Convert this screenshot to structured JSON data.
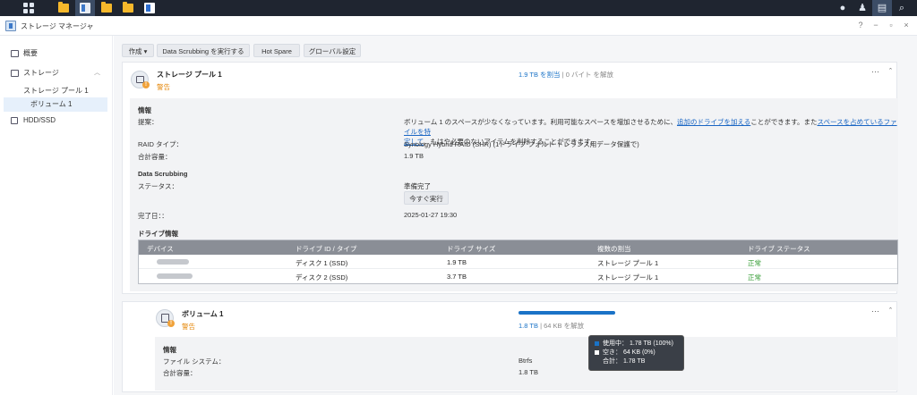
{
  "window": {
    "title": "ストレージ マネージャ"
  },
  "window_controls": [
    "?",
    "−",
    "▫",
    "×"
  ],
  "sidebar": {
    "items": [
      {
        "label": "概要",
        "icon": "overview-icon"
      },
      {
        "label": "ストレージ",
        "icon": "storage-icon"
      },
      {
        "label": "ストレージ プール 1"
      },
      {
        "label": "ボリューム 1"
      },
      {
        "label": "HDD/SSD",
        "icon": "hdd-icon"
      }
    ]
  },
  "toolbar": {
    "create": "作成",
    "scrubbing": "Data Scrubbing を実行する",
    "hot_spare": "Hot Spare",
    "global_settings": "グローバル設定"
  },
  "pool": {
    "title": "ストレージ プール 1",
    "status": "警告",
    "allocated": "1.9 TB を割当",
    "separator": "|",
    "released": "0 バイト を解放",
    "more": "···",
    "collapse": "ˆ",
    "info_header": "情報",
    "suggestion_label": "提案：",
    "suggestion_text_1": "ボリューム 1 のスペースが少なくなっています。利用可能なスペースを増加させるために、",
    "suggestion_link_1": "追加のドライブを加える",
    "suggestion_text_2": "ことができます。また",
    "suggestion_link_2a": "スペースを占めているファイルを特",
    "suggestion_link_2b": "定して",
    "suggestion_text_3": "、もはや必要のないアイテムを削除することができます。",
    "raid_label": "RAID タイプ：",
    "raid_value": "Synology Hybrid RAID (SHR) (1ドライブ フォルト トレランス用データ保護で)",
    "capacity_label": "合計容量：",
    "capacity_value": "1.9 TB",
    "scrubbing_header": "Data Scrubbing",
    "scrub_status_label": "ステータス：",
    "scrub_status_value": "準備完了",
    "run_now": "今すぐ実行",
    "completed_label": "完了日：：",
    "completed_value": "2025-01-27 19:30",
    "drive_header": "ドライブ情報"
  },
  "drive_table": {
    "columns": [
      "デバイス",
      "ドライブ ID / タイプ",
      "ドライブ サイズ",
      "複数の割当",
      "ドライブ ステータス"
    ],
    "rows": [
      {
        "id": "ディスク 1 (SSD)",
        "size": "1.9 TB",
        "alloc": "ストレージ プール 1",
        "status": "正常"
      },
      {
        "id": "ディスク 2 (SSD)",
        "size": "3.7 TB",
        "alloc": "ストレージ プール 1",
        "status": "正常"
      }
    ]
  },
  "volume": {
    "title": "ボリューム 1",
    "status": "警告",
    "used": "1.8 TB",
    "separator": "|",
    "free": "64 KB を解放",
    "usage_fraction": 1.0,
    "more": "···",
    "collapse": "ˆ",
    "info_header": "情報",
    "fs_label": "ファイル システム：",
    "fs_value": "Btrfs",
    "capacity_label": "合計容量：",
    "capacity_value": "1.8 TB"
  },
  "tooltip": {
    "used": "使用中： 1.78 TB (100%)",
    "free": "空き： 64 KB (0%)",
    "total": "合計： 1.78 TB"
  },
  "colors": {
    "accent": "#1a73c7",
    "warning": "#e58a0f",
    "ok": "#2f9a2f",
    "taskbar": "#1f2530"
  }
}
